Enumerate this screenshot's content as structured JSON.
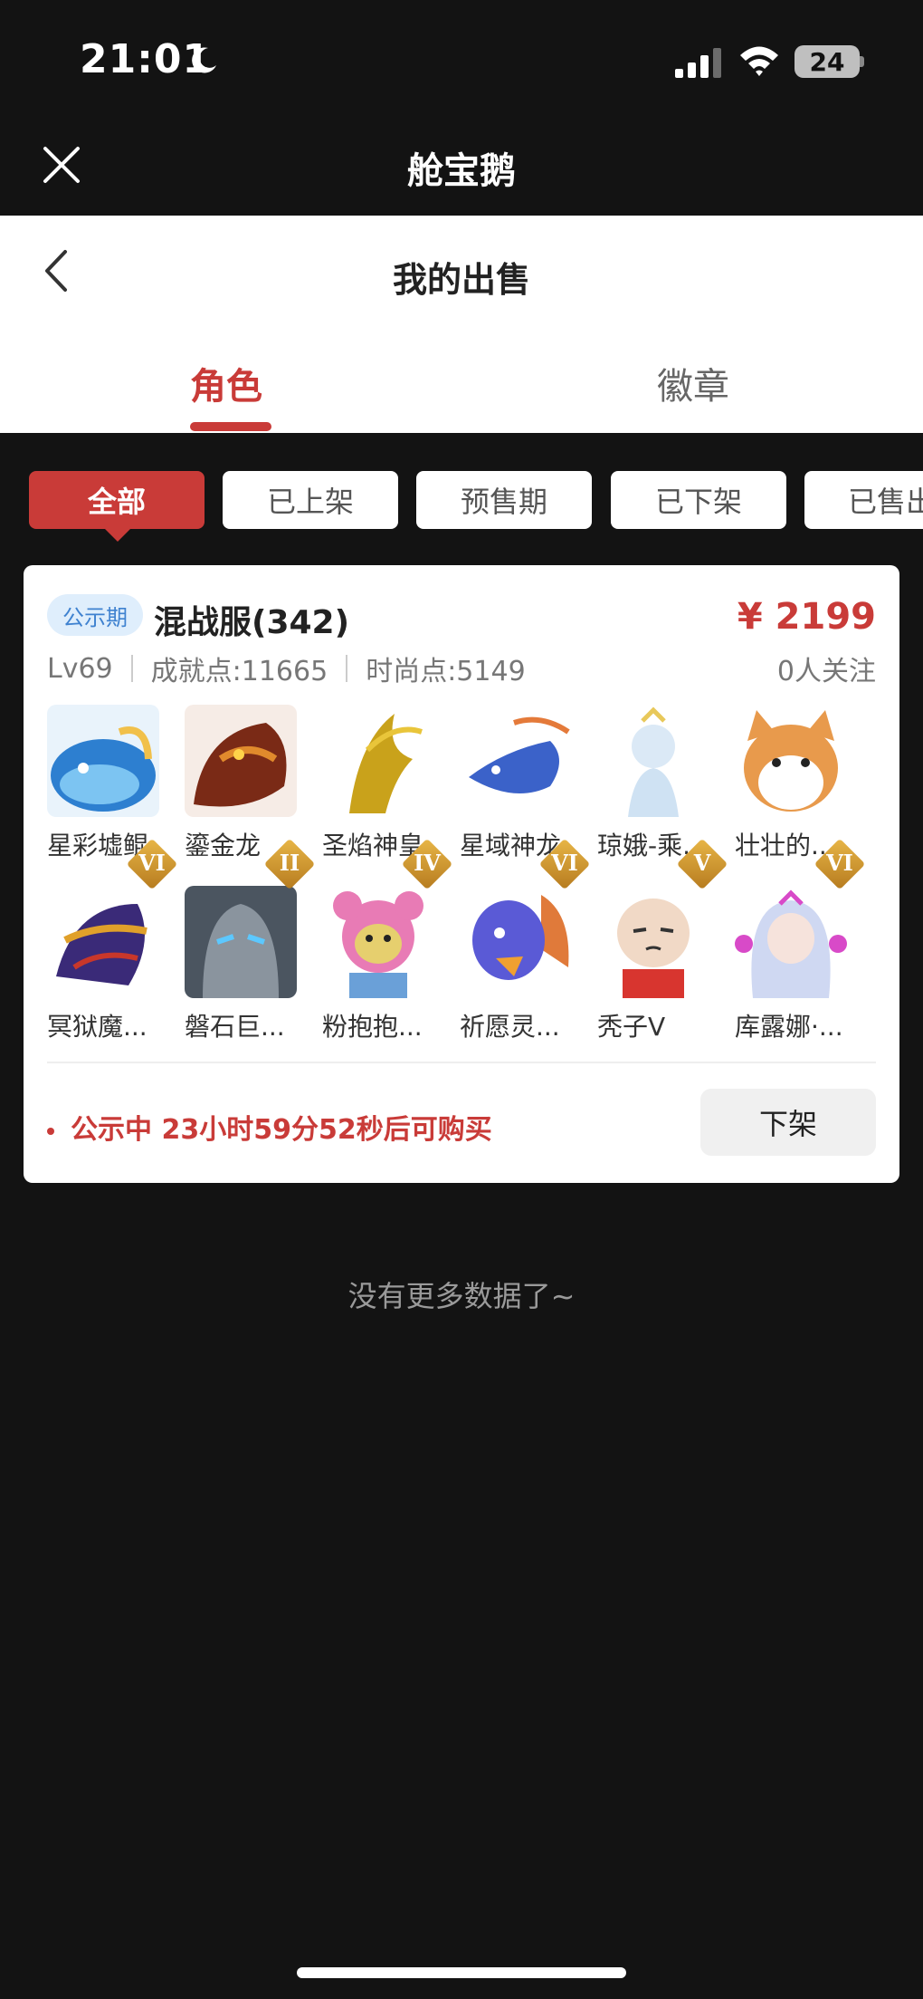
{
  "status_bar": {
    "time": "21:01",
    "battery": "24"
  },
  "mini_program": {
    "title": "舱宝鹅"
  },
  "page": {
    "title": "我的出售"
  },
  "tabs": [
    {
      "label": "角色",
      "active": true
    },
    {
      "label": "徽章",
      "active": false
    }
  ],
  "filters": [
    {
      "label": "全部",
      "active": true
    },
    {
      "label": "已上架",
      "active": false
    },
    {
      "label": "预售期",
      "active": false
    },
    {
      "label": "已下架",
      "active": false
    },
    {
      "label": "已售出",
      "active": false
    }
  ],
  "listing": {
    "badge": "公示期",
    "server": "混战服(342)",
    "price": "¥ 2199",
    "level": "Lv69",
    "achievement": "成就点:11665",
    "fashion": "时尚点:5149",
    "followers": "0人关注",
    "pets": [
      {
        "name": "星彩墟鲲",
        "rank": ""
      },
      {
        "name": "鎏金龙",
        "rank": ""
      },
      {
        "name": "圣焰神皇",
        "rank": ""
      },
      {
        "name": "星域神龙",
        "rank": ""
      },
      {
        "name": "琼娥-乘...",
        "rank": ""
      },
      {
        "name": "壮壮的...",
        "rank": ""
      },
      {
        "name": "冥狱魔...",
        "rank": "VI"
      },
      {
        "name": "磐石巨...",
        "rank": "II"
      },
      {
        "name": "粉抱抱...",
        "rank": "IV"
      },
      {
        "name": "祈愿灵...",
        "rank": "VI"
      },
      {
        "name": "秃子V",
        "rank": "V"
      },
      {
        "name": "库露娜·...",
        "rank": "VI"
      }
    ],
    "countdown": "公示中 23小时59分52秒后可购买",
    "delist_label": "下架"
  },
  "footer": {
    "no_more": "没有更多数据了~"
  },
  "colors": {
    "accent": "#c93b38",
    "background": "#131313",
    "badge_bg": "#dfeefc",
    "badge_text": "#3f82d0"
  }
}
